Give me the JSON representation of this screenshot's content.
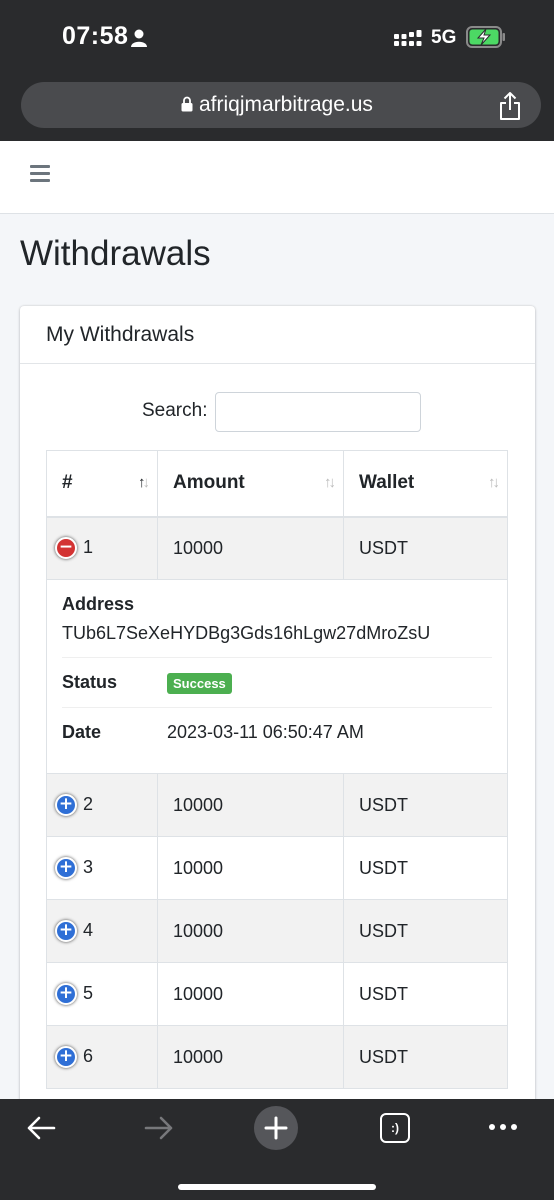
{
  "status_bar": {
    "time": "07:58",
    "network": "5G"
  },
  "browser": {
    "url": "afriqjmarbitrage.us",
    "tab_icon_label": ":)"
  },
  "page": {
    "title": "Withdrawals"
  },
  "card": {
    "header": "My Withdrawals",
    "search_label": "Search:",
    "search_value": ""
  },
  "table": {
    "columns": [
      "#",
      "Amount",
      "Wallet"
    ],
    "rows": [
      {
        "num": "1",
        "amount": "10000",
        "wallet": "USDT",
        "expanded": true
      },
      {
        "num": "2",
        "amount": "10000",
        "wallet": "USDT",
        "expanded": false
      },
      {
        "num": "3",
        "amount": "10000",
        "wallet": "USDT",
        "expanded": false
      },
      {
        "num": "4",
        "amount": "10000",
        "wallet": "USDT",
        "expanded": false
      },
      {
        "num": "5",
        "amount": "10000",
        "wallet": "USDT",
        "expanded": false
      },
      {
        "num": "6",
        "amount": "10000",
        "wallet": "USDT",
        "expanded": false
      }
    ],
    "detail": {
      "address_label": "Address",
      "address_value": "TUb6L7SeXeHYDBg3Gds16hLgw27dMroZsU",
      "status_label": "Status",
      "status_value": "Success",
      "date_label": "Date",
      "date_value": "2023-03-11 06:50:47 AM"
    },
    "sort_icon_glyph": "↑↓"
  },
  "colors": {
    "status_bar_bg": "#2a2b2d",
    "success_badge": "#4caf50",
    "collapse_control": "#d33333",
    "expand_control": "#2f6fd6",
    "striped_row": "#f2f2f2"
  },
  "icons": [
    "person-icon",
    "signal-icon",
    "battery-charging-icon",
    "lock-icon",
    "share-icon",
    "hamburger-menu-icon",
    "sort-icon",
    "collapse-icon",
    "expand-icon",
    "back-arrow-icon",
    "forward-arrow-icon",
    "new-tab-plus-icon",
    "tabs-icon",
    "more-dots-icon"
  ]
}
